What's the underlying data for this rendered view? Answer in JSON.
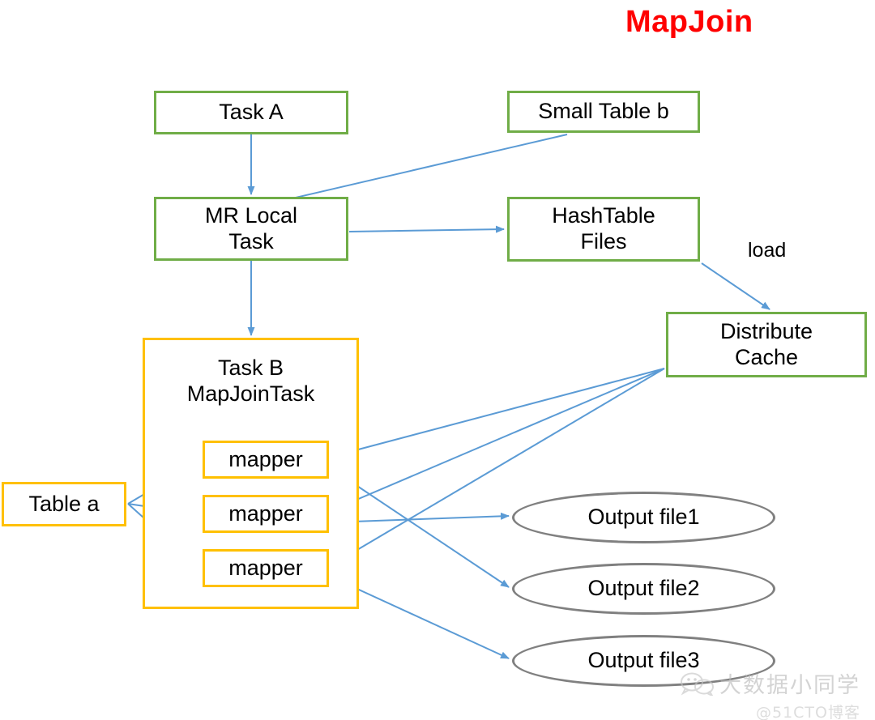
{
  "title": "MapJoin",
  "colors": {
    "title": "#FF0000",
    "green_border": "#70AD47",
    "orange_border": "#FFC000",
    "ellipse_border": "#808080",
    "arrow": "#5B9BD5",
    "background": "#FFFFFF",
    "text": "#000000"
  },
  "nodes": {
    "task_a": "Task A",
    "small_table_b": "Small Table b",
    "mr_local_task": "MR Local\nTask",
    "hashtable_files": "HashTable\nFiles",
    "distribute_cache": "Distribute\nCache",
    "task_b_group": "Task B\nMapJoinTask",
    "table_a": "Table a",
    "mapper_1": "mapper",
    "mapper_2": "mapper",
    "mapper_3": "mapper",
    "output_file_1": "Output file1",
    "output_file_2": "Output file2",
    "output_file_3": "Output file3"
  },
  "edge_labels": {
    "load": "load"
  },
  "edges": [
    {
      "from": "task_a",
      "to": "mr_local_task",
      "label": ""
    },
    {
      "from": "small_table_b",
      "to": "mr_local_task",
      "label": ""
    },
    {
      "from": "mr_local_task",
      "to": "hashtable_files",
      "label": ""
    },
    {
      "from": "mr_local_task",
      "to": "task_b_group",
      "label": ""
    },
    {
      "from": "hashtable_files",
      "to": "distribute_cache",
      "label": "load"
    },
    {
      "from": "table_a",
      "to": "mapper_1",
      "label": ""
    },
    {
      "from": "table_a",
      "to": "mapper_2",
      "label": ""
    },
    {
      "from": "table_a",
      "to": "mapper_3",
      "label": ""
    },
    {
      "from": "distribute_cache",
      "to": "mapper_1",
      "label": ""
    },
    {
      "from": "distribute_cache",
      "to": "mapper_2",
      "label": ""
    },
    {
      "from": "distribute_cache",
      "to": "mapper_3",
      "label": ""
    },
    {
      "from": "mapper_1",
      "to": "output_file_1",
      "label": ""
    },
    {
      "from": "mapper_2",
      "to": "output_file_2",
      "label": ""
    },
    {
      "from": "mapper_3",
      "to": "output_file_3",
      "label": ""
    }
  ],
  "watermark": {
    "account": "大数据小同学",
    "source": "@51CTO博客",
    "icon": "wechat-icon"
  }
}
